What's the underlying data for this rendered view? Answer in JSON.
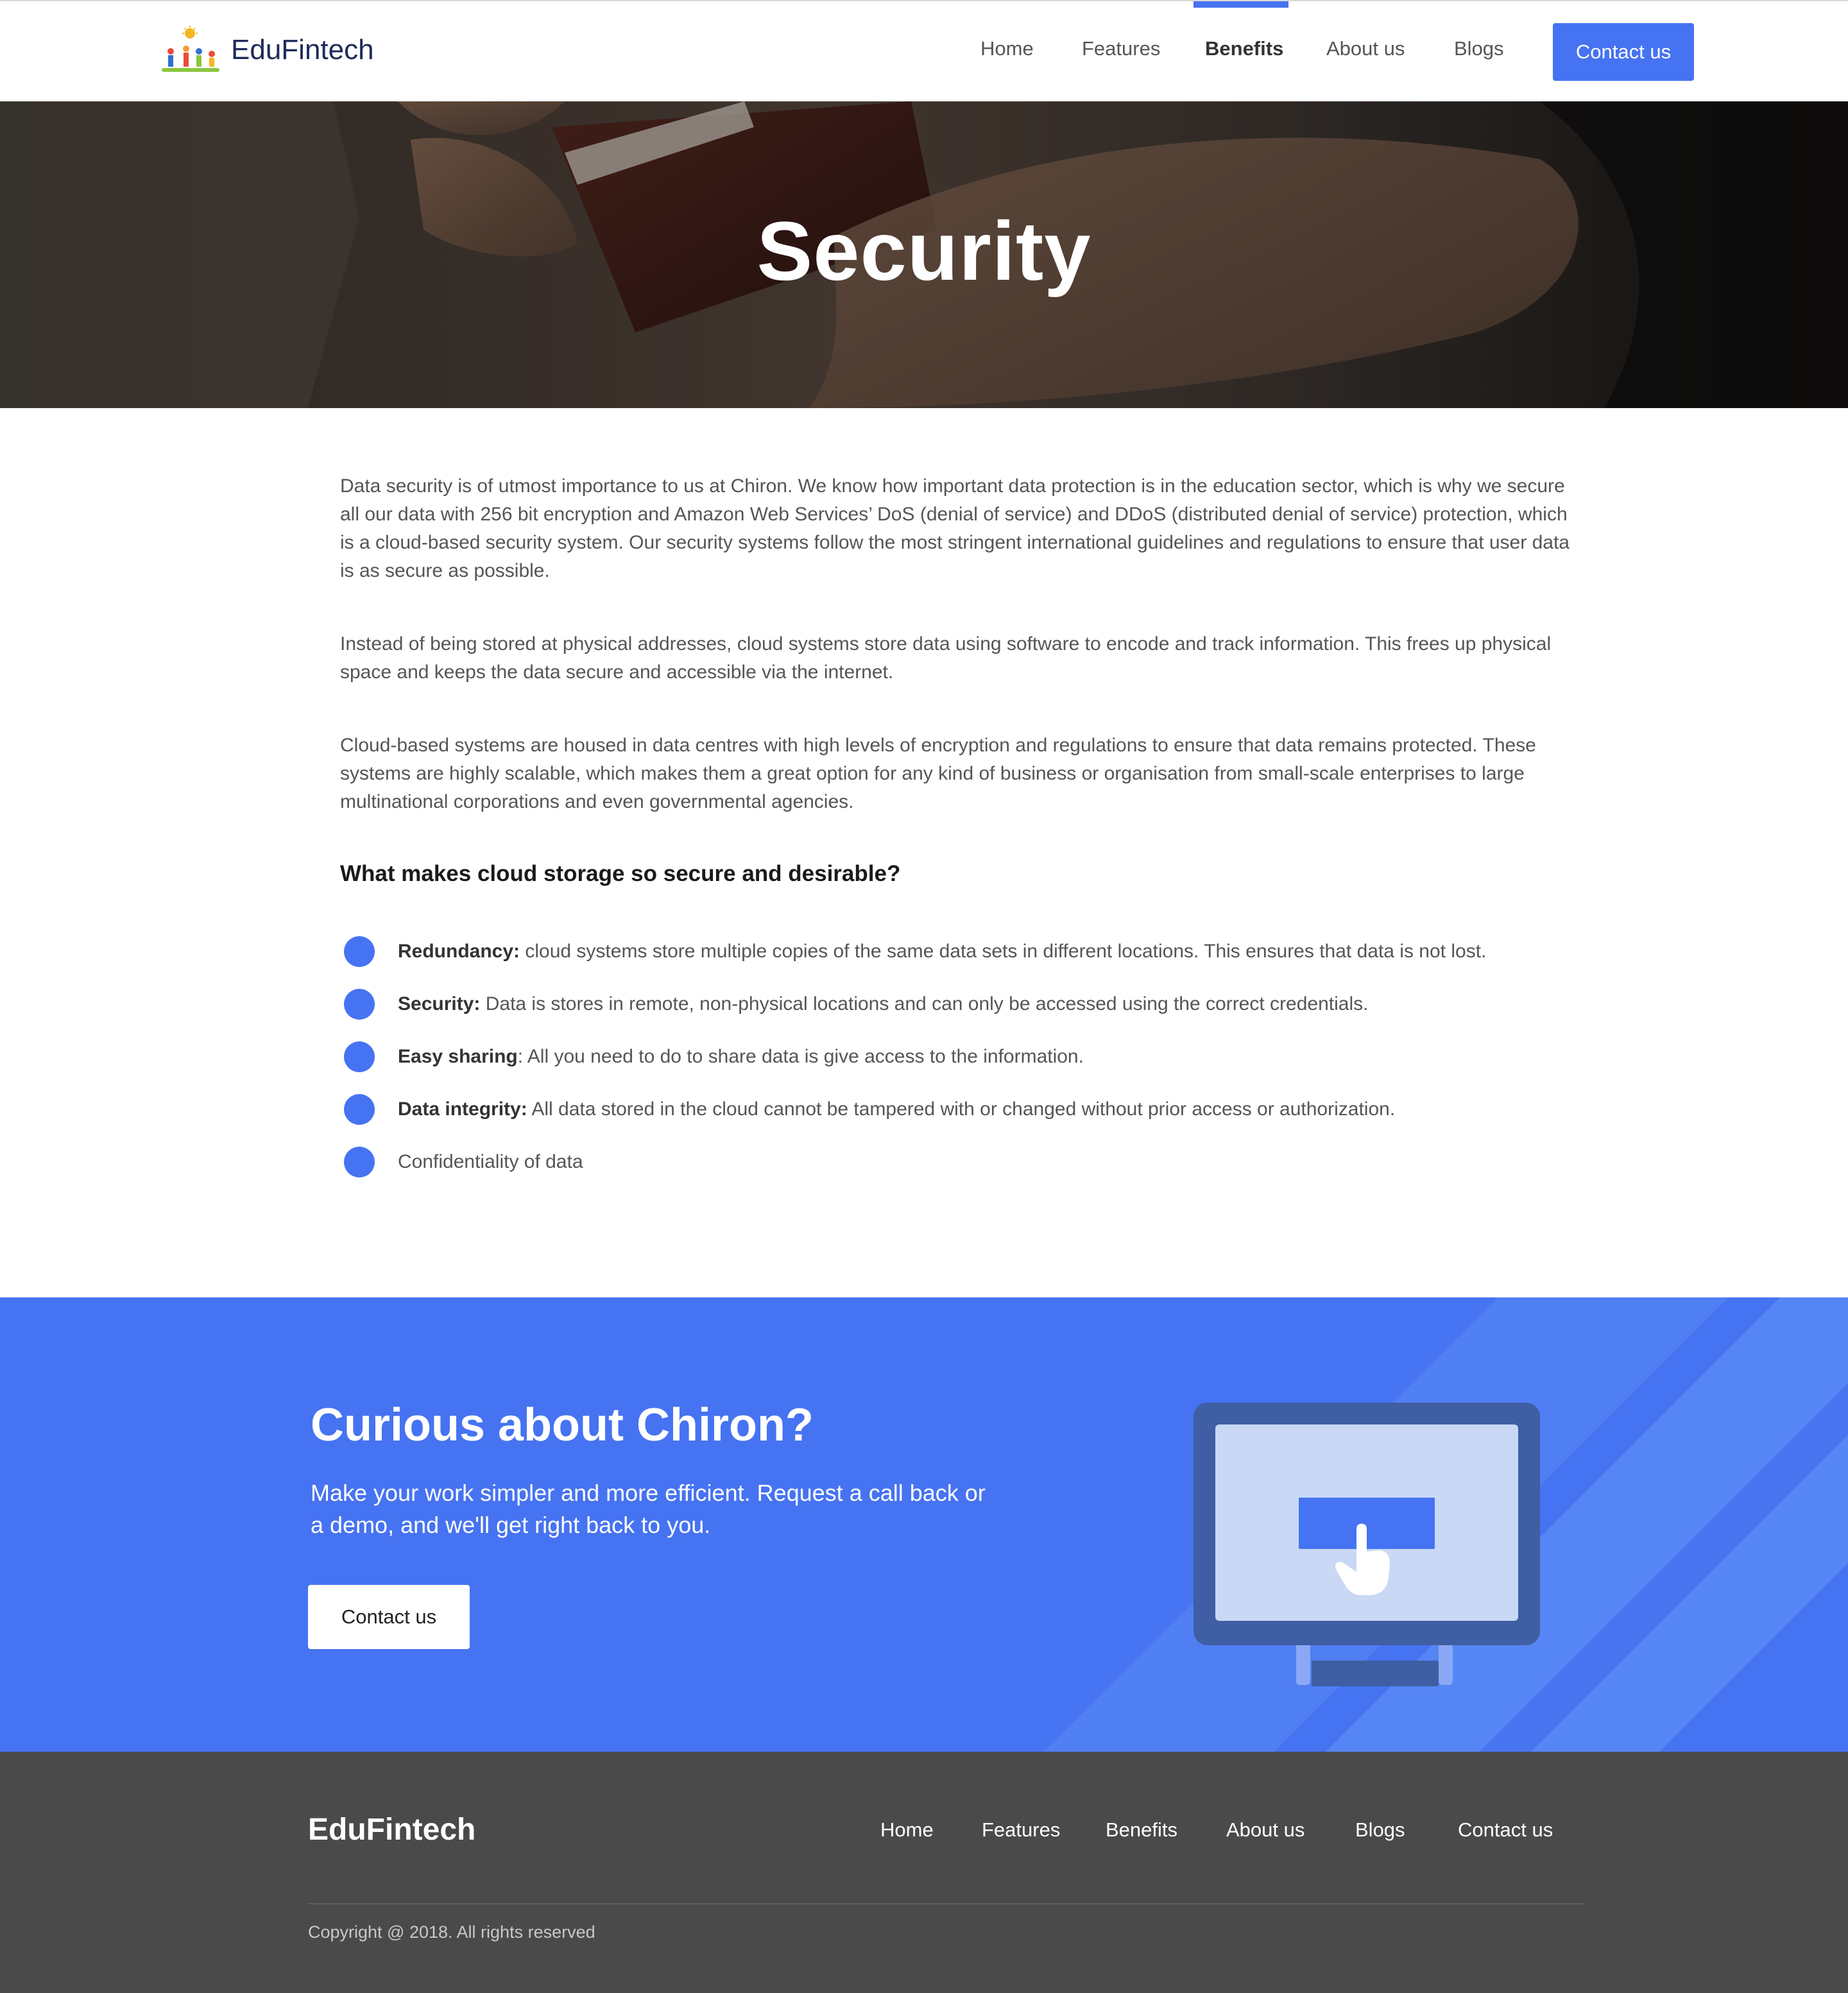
{
  "header": {
    "brand": "EduFintech",
    "nav": [
      {
        "label": "Home",
        "active": false
      },
      {
        "label": "Features",
        "active": false
      },
      {
        "label": "Benefits",
        "active": true
      },
      {
        "label": "About us",
        "active": false
      },
      {
        "label": "Blogs",
        "active": false
      }
    ],
    "contact_button": "Contact us"
  },
  "hero": {
    "title": "Security"
  },
  "content": {
    "paragraphs": [
      "Data security is of utmost importance to us at Chiron. We know how important data protection is in the education sector, which is why we secure all our data with 256 bit encryption and Amazon Web Services’ DoS (denial of service) and DDoS (distributed denial of service) protection, which is a cloud-based security system. Our security systems follow the most stringent international guidelines and regulations to ensure that user data is as secure as possible.",
      "Instead of being stored at physical addresses, cloud systems store data using software to encode and track information. This frees up physical space and keeps the data secure and accessible via the internet.",
      "Cloud-based systems are housed in data centres with high levels of encryption and regulations to ensure that data remains protected. These systems are highly scalable, which makes them a great option for any kind of business or organisation from small-scale enterprises to large multinational corporations and even governmental agencies."
    ],
    "subheading": "What makes cloud storage so secure and desirable?",
    "benefits": [
      {
        "title": "Redundancy:",
        "text": " cloud systems store multiple copies of the same data sets in different locations. This ensures that data is not lost."
      },
      {
        "title": "Security:",
        "text": " Data is stores in remote, non-physical locations and can only be accessed using the correct credentials."
      },
      {
        "title": "Easy sharing",
        "text": ": All you need to do to share data is give access to the information."
      },
      {
        "title": "Data integrity:",
        "text": " All data stored in the cloud cannot be tampered with or changed without prior access or authorization."
      },
      {
        "title": "",
        "text": "Confidentiality of data"
      }
    ]
  },
  "cta": {
    "title": "Curious about Chiron?",
    "text": "Make your work simpler and more efficient. Request a call back or a demo, and we'll get right back to you.",
    "button": "Contact us"
  },
  "footer": {
    "brand": "EduFintech",
    "links": [
      "Home",
      "Features",
      "Benefits",
      "About us",
      "Blogs",
      "Contact us"
    ],
    "copyright": "Copyright @ 2018. All rights reserved"
  },
  "colors": {
    "accent": "#4673f1",
    "footer_bg": "#4a4a4a",
    "monitor_frame": "#3f5ea3",
    "monitor_screen": "#c8d8f5"
  },
  "icons": [
    "logo-kids-sun-icon",
    "monitor-click-illustration",
    "hand-pointer-icon"
  ]
}
